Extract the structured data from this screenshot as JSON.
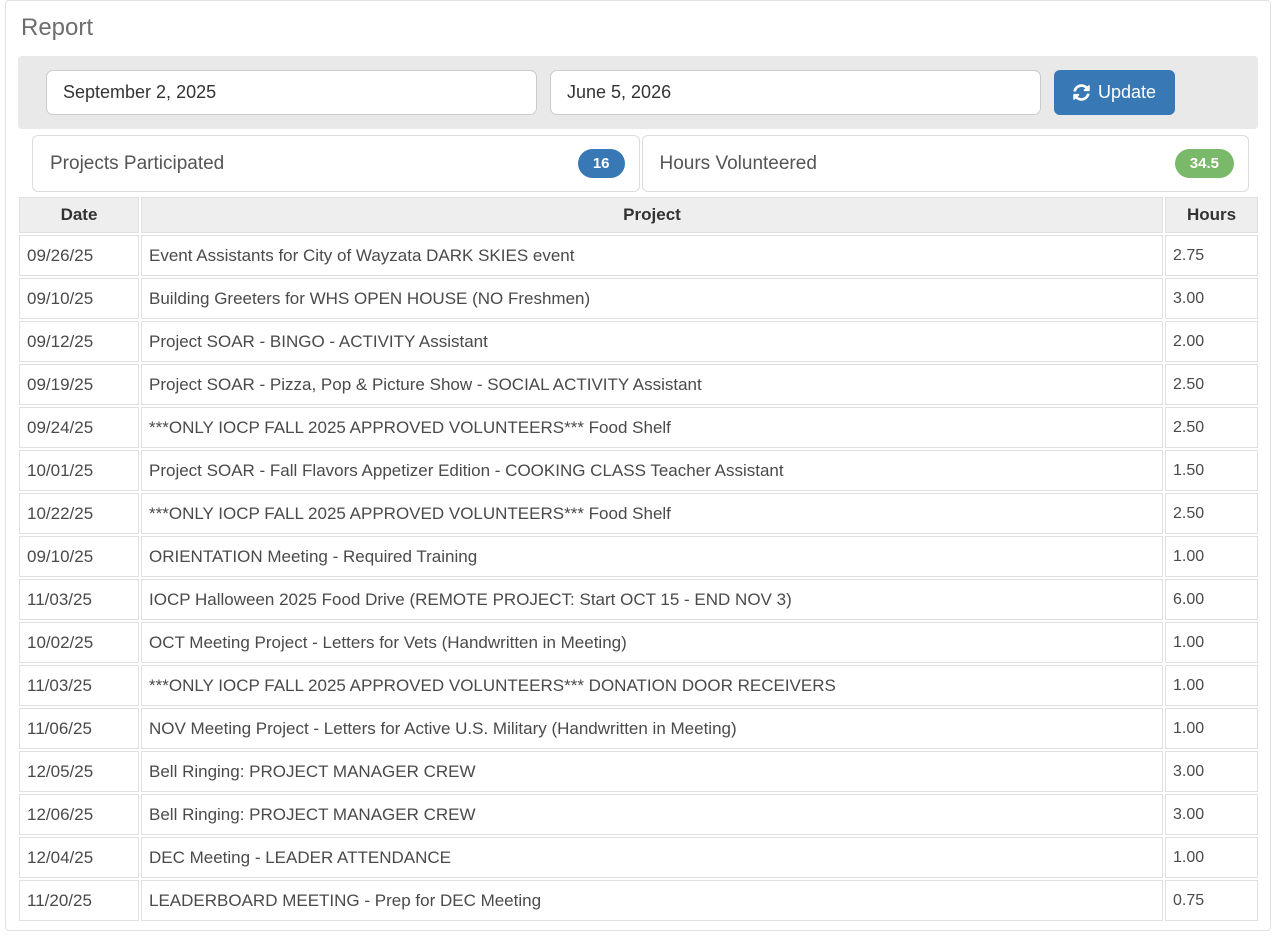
{
  "page": {
    "title": "Report"
  },
  "toolbar": {
    "start_date": "September 2, 2025",
    "end_date": "June 5, 2026",
    "update_label": "Update",
    "update_icon": "refresh-icon"
  },
  "stats": {
    "projects": {
      "label": "Projects Participated",
      "value": "16",
      "badge_color": "#3878b4"
    },
    "hours": {
      "label": "Hours Volunteered",
      "value": "34.5",
      "badge_color": "#7ab96a"
    }
  },
  "table": {
    "columns": [
      "Date",
      "Project",
      "Hours"
    ],
    "rows": [
      {
        "date": "09/26/25",
        "project": "Event Assistants for City of Wayzata DARK SKIES event",
        "hours": "2.75"
      },
      {
        "date": "09/10/25",
        "project": "Building Greeters for WHS OPEN HOUSE (NO Freshmen)",
        "hours": "3.00"
      },
      {
        "date": "09/12/25",
        "project": "Project SOAR - BINGO - ACTIVITY Assistant",
        "hours": "2.00"
      },
      {
        "date": "09/19/25",
        "project": "Project SOAR - Pizza, Pop & Picture Show - SOCIAL ACTIVITY Assistant",
        "hours": "2.50"
      },
      {
        "date": "09/24/25",
        "project": "***ONLY IOCP FALL 2025 APPROVED VOLUNTEERS*** Food Shelf",
        "hours": "2.50"
      },
      {
        "date": "10/01/25",
        "project": "Project SOAR - Fall Flavors Appetizer Edition - COOKING CLASS Teacher Assistant",
        "hours": "1.50"
      },
      {
        "date": "10/22/25",
        "project": "***ONLY IOCP FALL 2025 APPROVED VOLUNTEERS*** Food Shelf",
        "hours": "2.50"
      },
      {
        "date": "09/10/25",
        "project": "ORIENTATION Meeting - Required Training",
        "hours": "1.00"
      },
      {
        "date": "11/03/25",
        "project": "IOCP Halloween 2025 Food Drive (REMOTE PROJECT: Start OCT 15 - END NOV 3)",
        "hours": "6.00"
      },
      {
        "date": "10/02/25",
        "project": "OCT Meeting Project - Letters for Vets (Handwritten in Meeting)",
        "hours": "1.00"
      },
      {
        "date": "11/03/25",
        "project": "***ONLY IOCP FALL 2025 APPROVED VOLUNTEERS*** DONATION DOOR RECEIVERS",
        "hours": "1.00"
      },
      {
        "date": "11/06/25",
        "project": "NOV Meeting Project - Letters for Active U.S. Military (Handwritten in Meeting)",
        "hours": "1.00"
      },
      {
        "date": "12/05/25",
        "project": "Bell Ringing: PROJECT MANAGER CREW",
        "hours": "3.00"
      },
      {
        "date": "12/06/25",
        "project": "Bell Ringing: PROJECT MANAGER CREW",
        "hours": "3.00"
      },
      {
        "date": "12/04/25",
        "project": "DEC Meeting - LEADER ATTENDANCE",
        "hours": "1.00"
      },
      {
        "date": "11/20/25",
        "project": "LEADERBOARD MEETING - Prep for DEC Meeting",
        "hours": "0.75"
      }
    ]
  },
  "colors": {
    "accent_blue": "#3878b4",
    "accent_green": "#7ab96a",
    "toolbar_bg": "#e9e9e9",
    "header_bg": "#eeeeee",
    "border": "#e0e0e0"
  }
}
